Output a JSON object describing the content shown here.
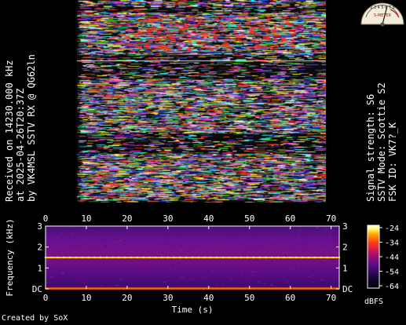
{
  "left_caption": [
    "Received on  14230.000 kHz",
    "at 2025-04-26T20:37Z",
    "by VK4MSL SSTV RX @ QG62ln"
  ],
  "right_caption": [
    "Signal strength: S6",
    "SSTV Mode: Scottie S2",
    "FSK ID: VK7?_K"
  ],
  "smeter": {
    "scale": "1 2 3 4 5 6 7 8 9",
    "label": "S-METER",
    "reading": "S6"
  },
  "credit": "Created by SoX",
  "chart_data": {
    "type": "heatmap",
    "title": "",
    "xlabel": "Time (s)",
    "ylabel": "Frequency (kHz)",
    "xlim": [
      0,
      72
    ],
    "ylim": [
      0,
      3
    ],
    "x_ticks": [
      "0",
      "10",
      "20",
      "30",
      "40",
      "50",
      "60",
      "70"
    ],
    "y_ticks_left": [
      "3",
      "2",
      "1",
      "DC"
    ],
    "y_ticks_right": [
      "3",
      "2",
      "1",
      "DC"
    ],
    "colorbar": {
      "unit": "dBFS",
      "ticks": [
        "-24",
        "-34",
        "-44",
        "-54",
        "-64"
      ],
      "stops": [
        "#000000",
        "#1a0640",
        "#5a0a86",
        "#b0106a",
        "#ff3a1a",
        "#ffa000",
        "#ffff60",
        "#ffffff"
      ]
    },
    "features": [
      {
        "kind": "tone",
        "freq_khz": 1.5,
        "t_start": 0,
        "t_end": 72,
        "color": "#ffcc00"
      },
      {
        "kind": "tone",
        "freq_khz": 0.02,
        "t_start": 0,
        "t_end": 72,
        "color": "#ff6600"
      }
    ],
    "grid": false
  }
}
